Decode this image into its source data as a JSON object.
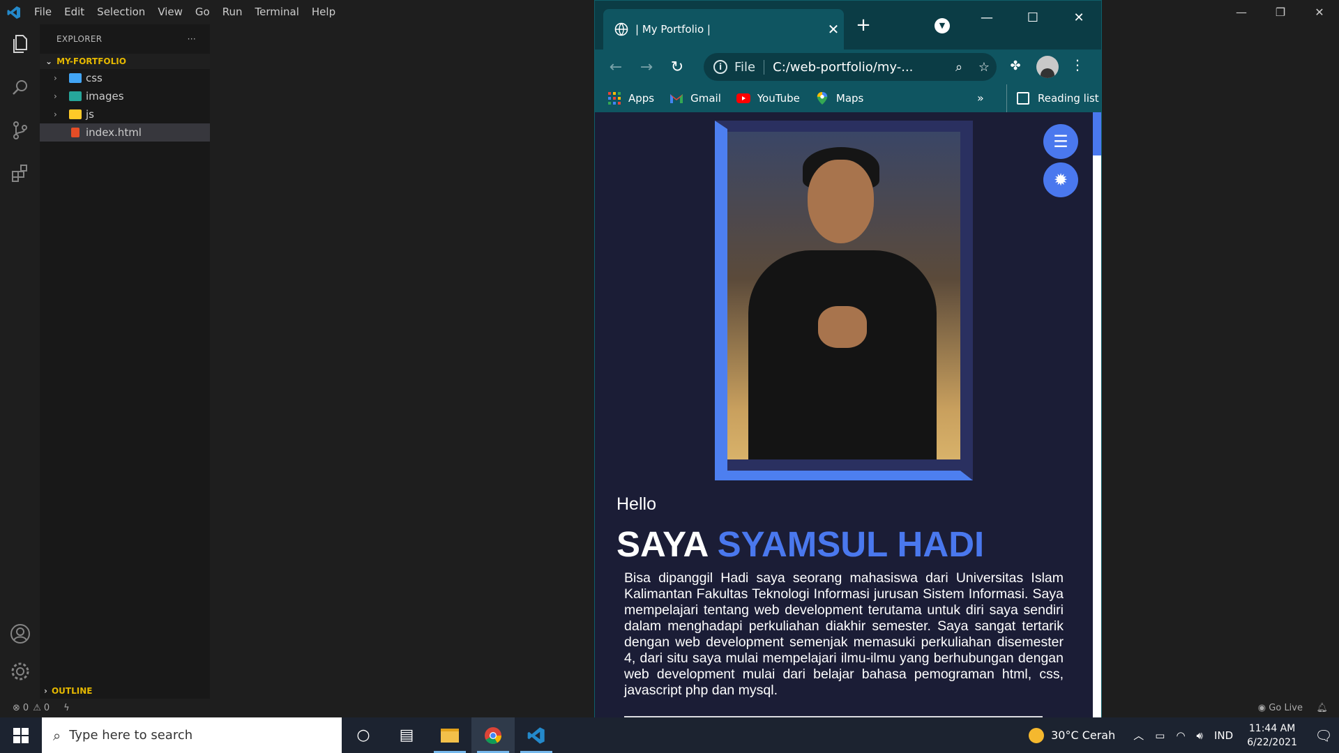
{
  "vscode": {
    "menu": [
      "File",
      "Edit",
      "Selection",
      "View",
      "Go",
      "Run",
      "Terminal",
      "Help"
    ],
    "explorer_title": "EXPLORER",
    "explorer_more": "···",
    "project": "MY-FORTFOLIO",
    "tree": [
      {
        "name": "css",
        "type": "folder",
        "icon_color": "#42a5f5"
      },
      {
        "name": "images",
        "type": "folder",
        "icon_color": "#26a69a"
      },
      {
        "name": "js",
        "type": "folder",
        "icon_color": "#ffca28"
      },
      {
        "name": "index.html",
        "type": "file",
        "icon_color": "#e44d26"
      }
    ],
    "outline": "OUTLINE",
    "status": {
      "errors": "0",
      "warnings": "0",
      "go_live": "Go Live"
    }
  },
  "chrome": {
    "tab_title": "| My Portfolio |",
    "url_scheme": "File",
    "url": "C:/web-portfolio/my-...",
    "bookmarks": [
      {
        "label": "Apps",
        "icon": "apps-icon"
      },
      {
        "label": "Gmail",
        "icon": "gmail-icon"
      },
      {
        "label": "YouTube",
        "icon": "youtube-icon"
      },
      {
        "label": "Maps",
        "icon": "maps-icon"
      }
    ],
    "bookmarks_more": "»",
    "reading_list": "Reading list"
  },
  "page": {
    "greeting": "Hello",
    "headline_prefix": "SAYA",
    "headline_name": "SYAMSUL HADI",
    "bio": "Bisa dipanggil Hadi saya seorang mahasiswa dari Universitas Islam Kalimantan Fakultas Teknologi Informasi jurusan Sistem Informasi. Saya mempelajari tentang web development terutama untuk diri saya sendiri dalam menghadapi perkuliahan diakhir semester. Saya sangat tertarik dengan web development semenjak memasuki perkuliahan disemester 4, dari situ saya mulai mempelajari ilmu-ilmu yang berhubungan dengan web development mulai dari belajar bahasa pemograman html, css, javascript php dan mysql.",
    "accent_color": "#4a78ee"
  },
  "taskbar": {
    "search_placeholder": "Type here to search",
    "weather": "30°C Cerah",
    "language": "IND",
    "time": "11:44 AM",
    "date": "6/22/2021"
  }
}
